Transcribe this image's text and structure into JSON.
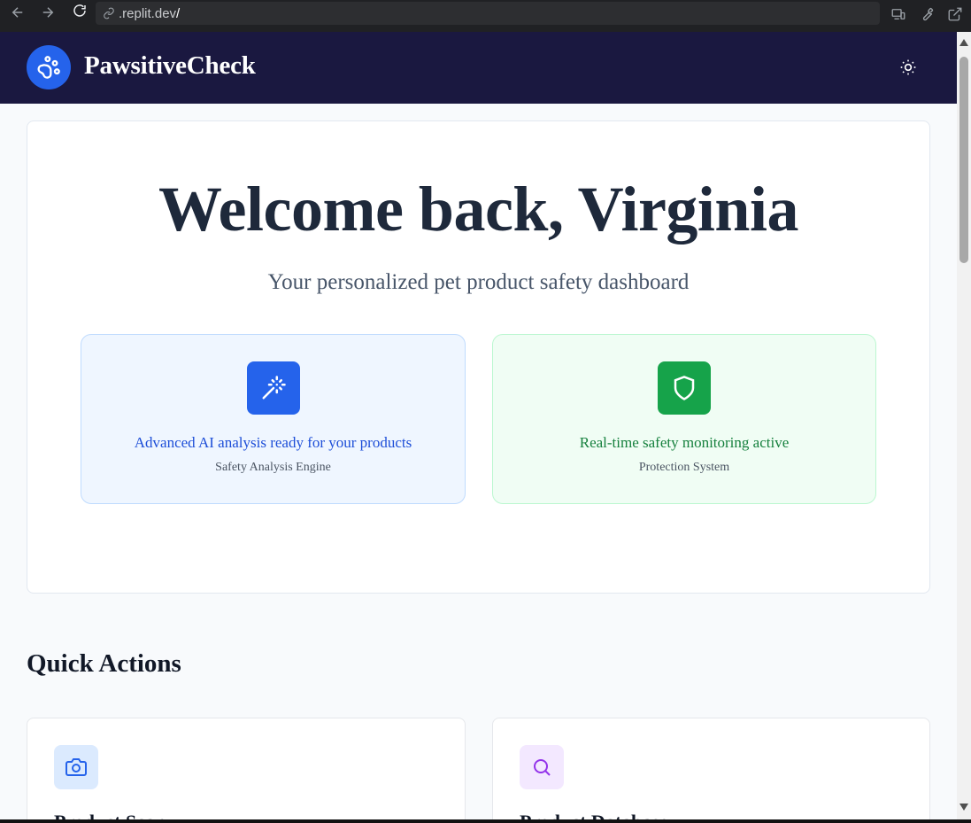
{
  "browser": {
    "url_domain": ".replit.dev",
    "url_path": "/"
  },
  "header": {
    "app_name": "PawsitiveCheck",
    "logo_icon": "paw-icon",
    "theme_icon": "sun-icon"
  },
  "welcome": {
    "title": "Welcome back, Virginia",
    "subtitle": "Your personalized pet product safety dashboard",
    "features": [
      {
        "icon": "magic-wand-icon",
        "text": "Advanced AI analysis ready for your products",
        "label": "Safety Analysis Engine",
        "color": "#2563eb"
      },
      {
        "icon": "shield-icon",
        "text": "Real-time safety monitoring active",
        "label": "Protection System",
        "color": "#16a34a"
      }
    ]
  },
  "quick_actions": {
    "heading": "Quick Actions",
    "items": [
      {
        "icon": "camera-icon",
        "title": "Product Scan",
        "color": "#2563eb"
      },
      {
        "icon": "search-icon",
        "title": "Product Database",
        "color": "#9333ea"
      }
    ]
  }
}
